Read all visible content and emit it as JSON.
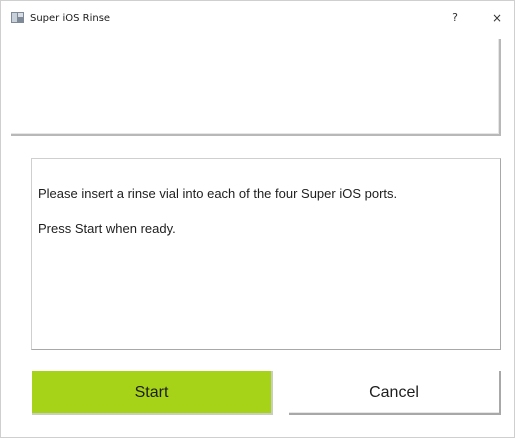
{
  "window": {
    "title": "Super iOS Rinse",
    "help_label": "?",
    "close_label": "×"
  },
  "message": {
    "line1": "Please insert a rinse vial into each of the four Super iOS ports.",
    "line2": "Press Start when ready."
  },
  "buttons": {
    "start_label": "Start",
    "cancel_label": "Cancel"
  },
  "colors": {
    "start_button_bg": "#a6d317",
    "window_bg": "#ffffff"
  }
}
